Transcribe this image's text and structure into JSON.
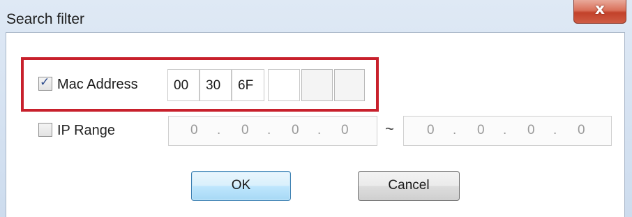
{
  "window": {
    "title": "Search filter",
    "close_label": "x"
  },
  "mac": {
    "checked": true,
    "label": "Mac Address",
    "octets": [
      "00",
      "30",
      "6F",
      "",
      "",
      ""
    ]
  },
  "ip_range": {
    "checked": false,
    "label": "IP Range",
    "separator": "~",
    "start": [
      "0",
      ".",
      "0",
      ".",
      "0",
      ".",
      "0"
    ],
    "end": [
      "0",
      ".",
      "0",
      ".",
      "0",
      ".",
      "0"
    ]
  },
  "buttons": {
    "ok_label": "OK",
    "cancel_label": "Cancel"
  },
  "colors": {
    "highlight": "#c8202c",
    "close_button": "#c2412a"
  }
}
